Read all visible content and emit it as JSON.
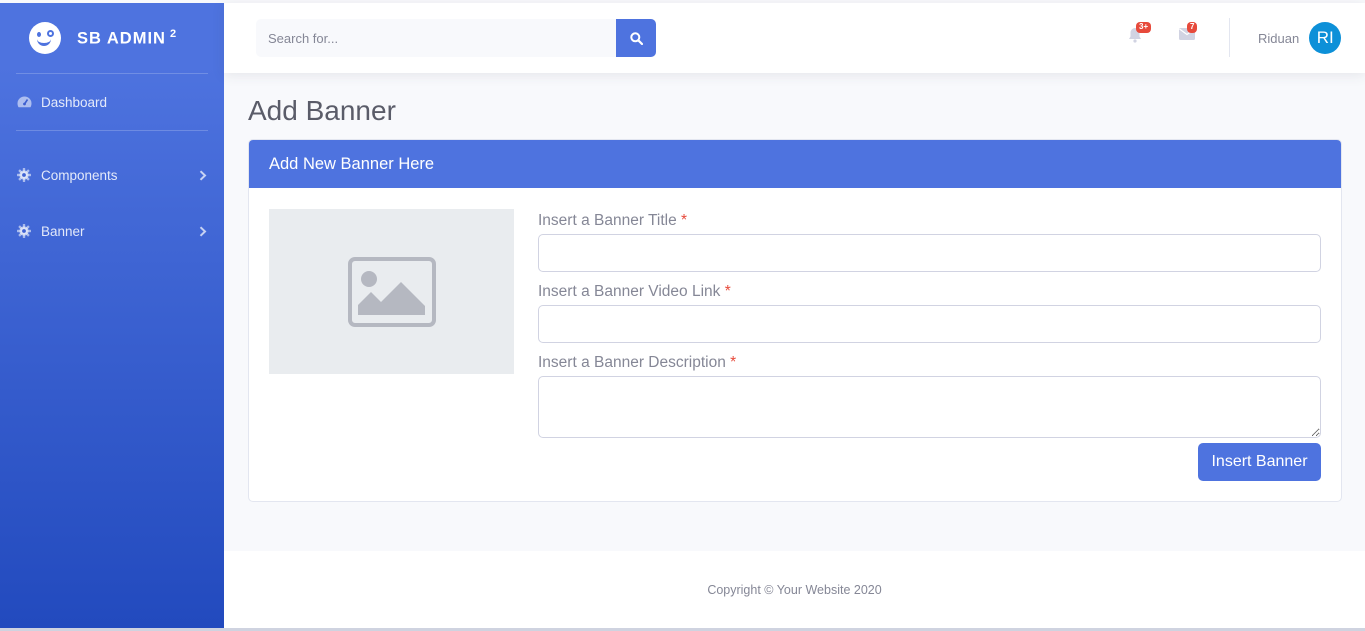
{
  "sidebar": {
    "brand": {
      "name": "SB ADMIN",
      "sup": "2",
      "icon": "laugh-wink-icon"
    },
    "items": [
      {
        "label": "Dashboard",
        "icon": "tachometer-icon"
      },
      {
        "label": "Components",
        "icon": "cog-icon",
        "has_chevron": true
      },
      {
        "label": "Banner",
        "icon": "cog-icon",
        "has_chevron": true
      }
    ]
  },
  "topbar": {
    "search": {
      "placeholder": "Search for...",
      "value": "",
      "button_icon": "search-icon"
    },
    "alerts": {
      "icon": "bell-icon",
      "badge": "3+"
    },
    "messages": {
      "icon": "envelope-icon",
      "badge": "7"
    },
    "user": {
      "name": "Riduan",
      "initials": "RI"
    }
  },
  "page": {
    "title": "Add Banner",
    "card": {
      "header": "Add New Banner Here",
      "image_placeholder_icon": "image-icon",
      "fields": [
        {
          "label": "Insert a Banner Title",
          "required": "*",
          "value": ""
        },
        {
          "label": "Insert a Banner Video Link",
          "required": "*",
          "value": ""
        },
        {
          "label": "Insert a Banner Description",
          "required": "*",
          "value": ""
        }
      ],
      "submit_label": "Insert Banner"
    }
  },
  "footer": {
    "text": "Copyright © Your Website 2020"
  },
  "colors": {
    "primary": "#4e73df",
    "primary_dark": "#224abe",
    "danger": "#e74a3b",
    "avatar": "#0d90d8"
  }
}
